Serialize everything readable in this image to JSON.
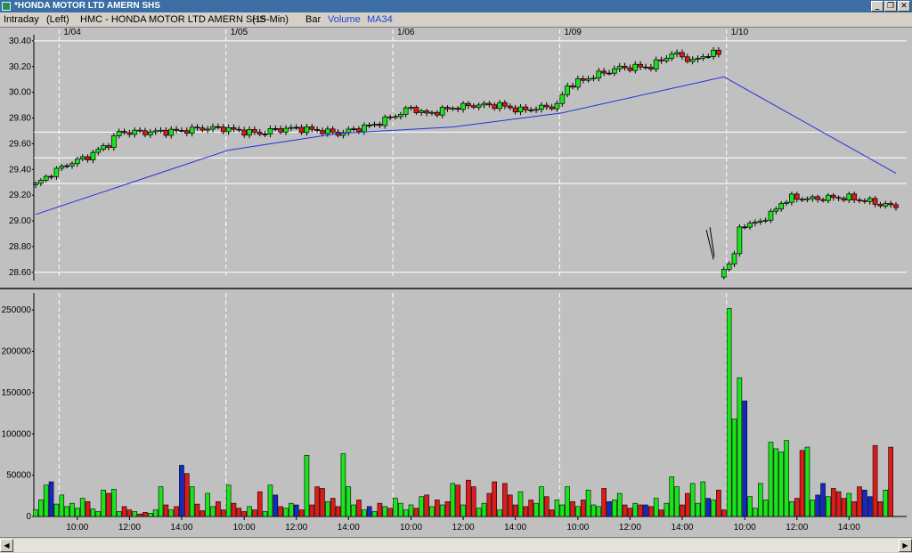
{
  "window": {
    "title": "*HONDA MOTOR LTD AMERN SHS",
    "buttons": {
      "minimize": "_",
      "restore": "❐",
      "close": "✕"
    }
  },
  "toolbar": {
    "mode": "Intraday",
    "axis_side": "(Left)",
    "symbol": "HMC - HONDA MOTOR LTD AMERN SHS",
    "interval": "(15-Min)",
    "chart_style": "Bar",
    "study1": "Volume",
    "study2": "MA34"
  },
  "colors": {
    "up": "#19e619",
    "down": "#e01919",
    "neutral": "#1428c8",
    "ma": "#2430e0",
    "background": "#c0c0c0"
  },
  "chart_data": [
    {
      "type": "line",
      "ylim": [
        28.55,
        30.42
      ],
      "yticks": [
        "30.40",
        "30.20",
        "30.00",
        "29.80",
        "29.60",
        "29.40",
        "29.20",
        "29.00",
        "28.80",
        "28.60"
      ],
      "ytick_values": [
        30.4,
        30.2,
        30.0,
        29.8,
        29.6,
        29.4,
        29.2,
        29.0,
        28.8,
        28.6
      ],
      "horizontal_lines": [
        30.4,
        29.69,
        29.49,
        29.29,
        28.6
      ],
      "date_labels": [
        "1/04",
        "1/05",
        "1/06",
        "1/09",
        "1/10"
      ],
      "date_bars": [
        5,
        37,
        69,
        101,
        133
      ],
      "total_bars": 166,
      "price_start": 29.28,
      "price_end": 29.11,
      "close_anchors": [
        [
          0,
          29.28
        ],
        [
          3,
          29.37
        ],
        [
          6,
          29.44
        ],
        [
          10,
          29.5
        ],
        [
          14,
          29.6
        ],
        [
          16,
          29.69
        ],
        [
          22,
          29.69
        ],
        [
          28,
          29.7
        ],
        [
          32,
          29.72
        ],
        [
          36,
          29.72
        ],
        [
          39,
          29.7
        ],
        [
          43,
          29.68
        ],
        [
          46,
          29.71
        ],
        [
          50,
          29.72
        ],
        [
          55,
          29.7
        ],
        [
          58,
          29.68
        ],
        [
          62,
          29.72
        ],
        [
          65,
          29.75
        ],
        [
          69,
          29.82
        ],
        [
          72,
          29.88
        ],
        [
          75,
          29.83
        ],
        [
          80,
          29.88
        ],
        [
          84,
          29.9
        ],
        [
          89,
          29.9
        ],
        [
          93,
          29.86
        ],
        [
          97,
          29.88
        ],
        [
          100,
          29.9
        ],
        [
          102,
          30.05
        ],
        [
          108,
          30.14
        ],
        [
          112,
          30.19
        ],
        [
          118,
          30.2
        ],
        [
          122,
          30.3
        ],
        [
          124,
          30.28
        ],
        [
          126,
          30.24
        ],
        [
          129,
          30.3
        ],
        [
          131,
          30.3
        ],
        [
          132,
          28.63
        ],
        [
          134,
          28.72
        ],
        [
          135,
          28.96
        ],
        [
          138,
          28.98
        ],
        [
          141,
          29.05
        ],
        [
          143,
          29.14
        ],
        [
          145,
          29.18
        ],
        [
          149,
          29.17
        ],
        [
          152,
          29.18
        ],
        [
          156,
          29.18
        ],
        [
          160,
          29.15
        ],
        [
          162,
          29.13
        ],
        [
          165,
          29.11
        ]
      ],
      "ma34": [
        [
          0,
          29.05
        ],
        [
          37,
          29.55
        ],
        [
          58,
          29.68
        ],
        [
          80,
          29.73
        ],
        [
          101,
          29.84
        ],
        [
          132,
          30.12
        ],
        [
          165,
          29.37
        ]
      ],
      "annotation_ticks": [
        {
          "x": 130,
          "from": 28.8,
          "to": 28.75
        }
      ]
    },
    {
      "type": "bar",
      "series": [
        {
          "values_hint": "volume per 15-min bar"
        }
      ],
      "ylim": [
        0,
        262000
      ],
      "yticks": [
        "250000",
        "200000",
        "150000",
        "100000",
        "50000",
        "0"
      ],
      "ytick_values": [
        250000,
        200000,
        150000,
        100000,
        50000,
        0
      ],
      "xticks": [
        "10:00",
        "12:00",
        "14:00",
        "10:00",
        "12:00",
        "14:00",
        "10:00",
        "12:00",
        "14:00",
        "10:00",
        "12:00",
        "14:00",
        "10:00",
        "12:00",
        "14:00"
      ],
      "xtick_bars": [
        8,
        18,
        28,
        40,
        50,
        60,
        72,
        82,
        92,
        104,
        114,
        124,
        136,
        146,
        156
      ],
      "volume": [
        8000,
        20000,
        38000,
        42000,
        15000,
        26000,
        12000,
        16000,
        10000,
        22000,
        18000,
        9000,
        6000,
        32000,
        28000,
        33000,
        6000,
        12000,
        8000,
        6000,
        3000,
        5000,
        4000,
        8000,
        36000,
        14000,
        8000,
        12000,
        62000,
        52000,
        36000,
        15000,
        7000,
        28000,
        12000,
        18000,
        8000,
        38000,
        16000,
        10000,
        6000,
        12000,
        8000,
        30000,
        6000,
        38000,
        26000,
        12000,
        10000,
        16000,
        14000,
        8000,
        74000,
        14000,
        36000,
        34000,
        18000,
        22000,
        12000,
        76000,
        36000,
        14000,
        20000,
        8000,
        12000,
        6000,
        16000,
        12000,
        10000,
        22000,
        16000,
        8000,
        14000,
        10000,
        24000,
        26000,
        12000,
        20000,
        14000,
        18000,
        40000,
        38000,
        14000,
        44000,
        36000,
        10000,
        16000,
        28000,
        42000,
        8000,
        40000,
        26000,
        14000,
        30000,
        12000,
        20000,
        16000,
        36000,
        24000,
        8000,
        20000,
        14000,
        36000,
        18000,
        12000,
        20000,
        32000,
        14000,
        12000,
        34000,
        18000,
        20000,
        28000,
        14000,
        10000,
        16000,
        14000,
        14000,
        12000,
        22000,
        8000,
        16000,
        48000,
        36000,
        14000,
        28000,
        40000,
        16000,
        42000,
        22000,
        20000,
        32000,
        8000,
        252000,
        118000,
        168000,
        140000,
        24000,
        10000,
        40000,
        20000,
        90000,
        82000,
        78000,
        92000,
        18000,
        22000,
        80000,
        84000,
        20000,
        26000,
        40000,
        24000,
        34000,
        30000,
        22000,
        28000,
        18000,
        36000,
        32000,
        24000,
        86000,
        18000,
        32000,
        84000
      ]
    }
  ]
}
